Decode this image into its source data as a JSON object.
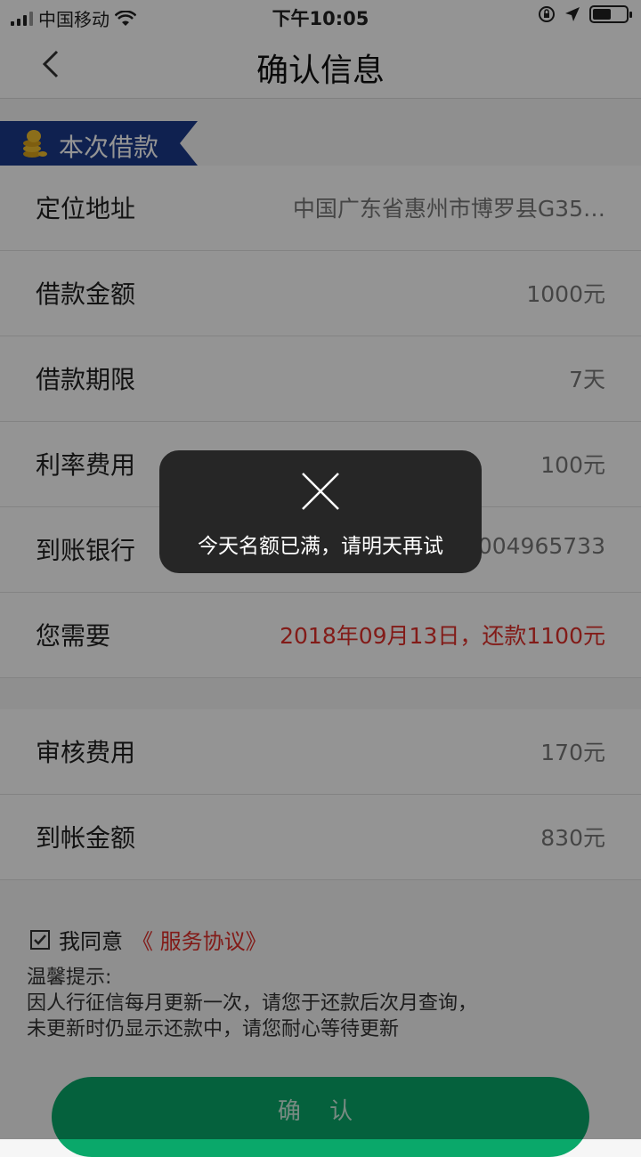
{
  "status": {
    "carrier": "中国移动",
    "time": "下午10:05",
    "battery_level": 0.55
  },
  "nav": {
    "title": "确认信息"
  },
  "section": {
    "title": "本次借款",
    "icon": "coin-stack-icon"
  },
  "loan_rows": [
    {
      "label": "定位地址",
      "value": "中国广东省惠州市博罗县G35…"
    },
    {
      "label": "借款金额",
      "value": "1000元"
    },
    {
      "label": "借款期限",
      "value": "7天"
    },
    {
      "label": "利率费用",
      "value": "100元"
    },
    {
      "label": "到账银行",
      "value": "0004965733"
    },
    {
      "label": "您需要",
      "value": "2018年09月13日，还款1100元"
    }
  ],
  "fee_rows": [
    {
      "label": "审核费用",
      "value": "170元"
    },
    {
      "label": "到帐金额",
      "value": "830元"
    }
  ],
  "agreement": {
    "prefix": "我同意",
    "link": "《 服务协议》",
    "checked": true
  },
  "tips": {
    "title": "温馨提示:",
    "line1": "因人行征信每月更新一次，请您于还款后次月查询，",
    "line2": "未更新时仍显示还款中，请您耐心等待更新"
  },
  "confirm_label": "确 认",
  "toast": {
    "message": "今天名额已满，请明天再试"
  },
  "colors": {
    "accent_red": "#e0302a",
    "button_green": "#0aa86a",
    "banner_blue": "#1a3a8a"
  }
}
